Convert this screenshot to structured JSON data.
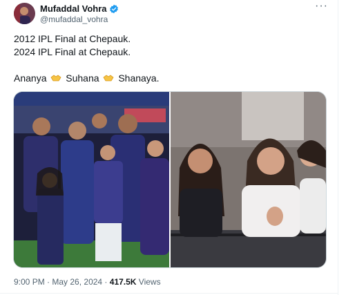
{
  "tweet": {
    "display_name": "Mufaddal Vohra",
    "handle": "@mufaddal_vohra",
    "more_label": "···",
    "lines": [
      "2012 IPL Final at Chepauk.",
      "2024 IPL Final at Chepauk."
    ],
    "names": [
      "Ananya",
      "Suhana",
      "Shanaya."
    ],
    "separator_icon": "handshake-icon"
  },
  "meta": {
    "time": "9:00 PM",
    "dot": " · ",
    "date": "May 26, 2024",
    "views_count": "417.5K",
    "views_label": " Views"
  },
  "colors": {
    "verified": "#1d9bf0",
    "muted": "#536471",
    "text": "#0f1419"
  }
}
